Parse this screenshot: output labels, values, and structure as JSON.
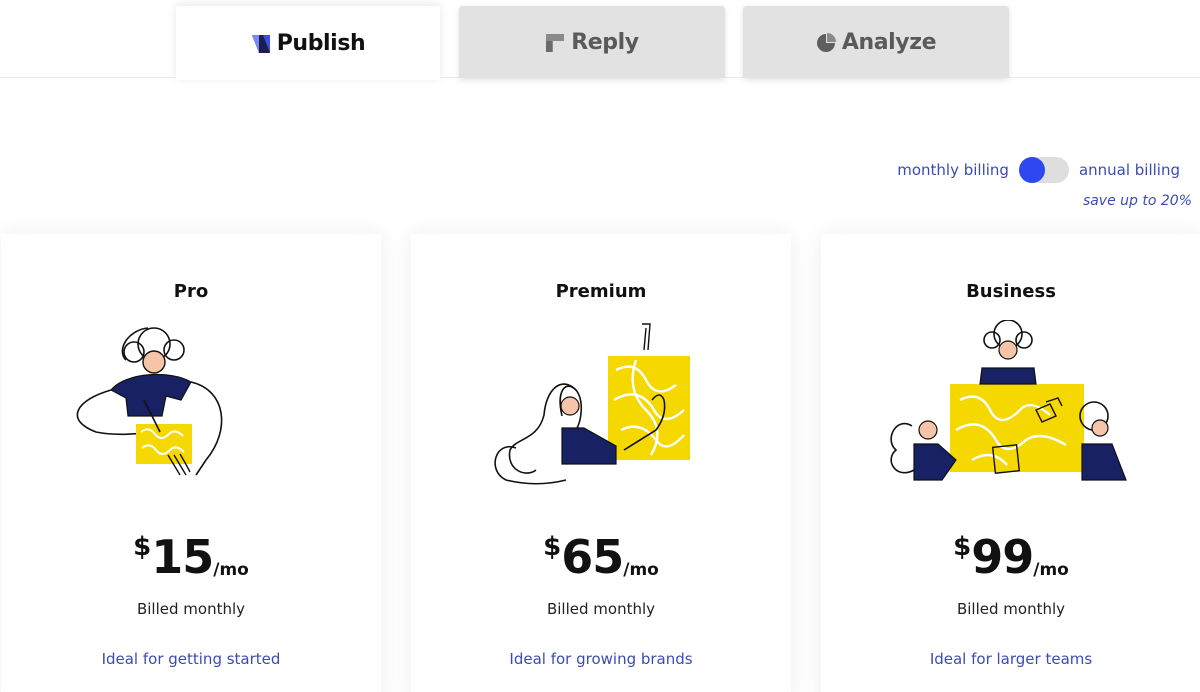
{
  "tabs": [
    {
      "label": "Publish",
      "icon": "publish-logo-icon",
      "active": true
    },
    {
      "label": "Reply",
      "icon": "reply-logo-icon",
      "active": false
    },
    {
      "label": "Analyze",
      "icon": "analyze-pie-icon",
      "active": false
    }
  ],
  "billing": {
    "monthly_label": "monthly billing",
    "annual_label": "annual billing",
    "save_note": "save up to 20%",
    "selected": "monthly"
  },
  "plans": [
    {
      "name": "Pro",
      "currency": "$",
      "amount": "15",
      "period": "/mo",
      "billed": "Billed monthly",
      "ideal": "Ideal for getting started"
    },
    {
      "name": "Premium",
      "currency": "$",
      "amount": "65",
      "period": "/mo",
      "billed": "Billed monthly",
      "ideal": "Ideal for growing brands"
    },
    {
      "name": "Business",
      "currency": "$",
      "amount": "99",
      "period": "/mo",
      "billed": "Billed monthly",
      "ideal": "Ideal for larger teams"
    }
  ],
  "colors": {
    "accent": "#2f47f0",
    "link": "#3b4bb5",
    "illustration_yellow": "#f5d800",
    "illustration_navy": "#172164"
  }
}
